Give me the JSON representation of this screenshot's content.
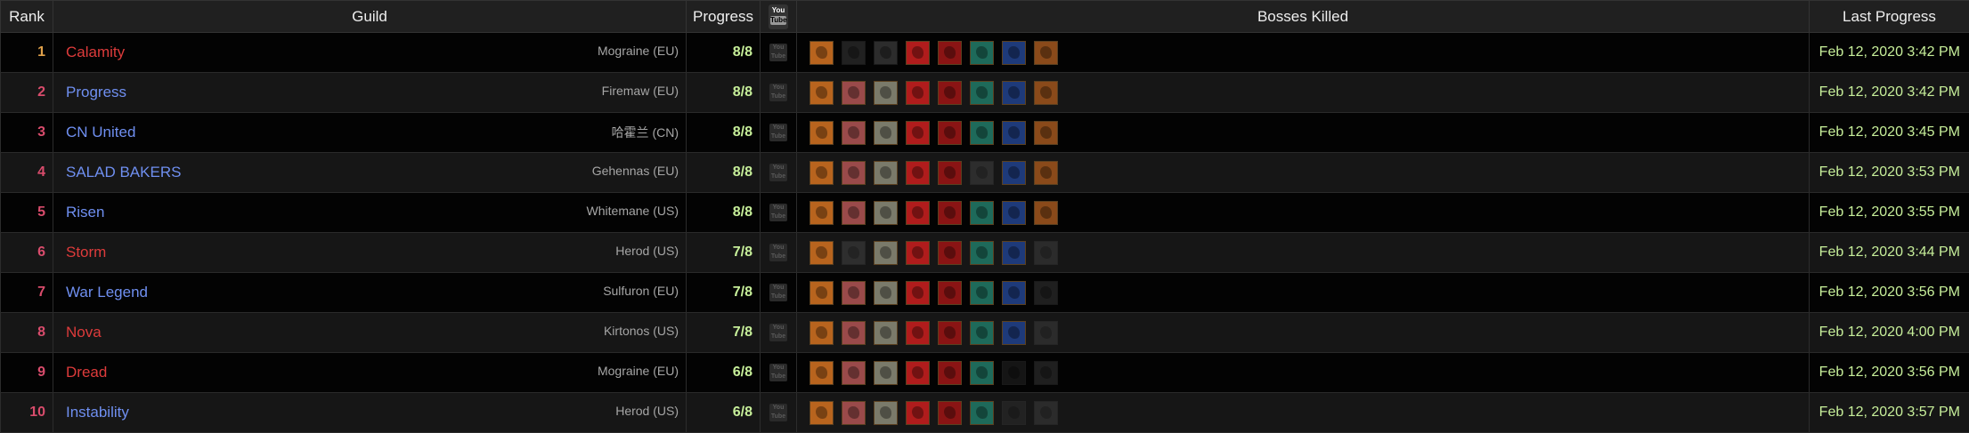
{
  "headers": {
    "rank": "Rank",
    "guild": "Guild",
    "progress": "Progress",
    "bosses": "Bosses Killed",
    "last": "Last Progress",
    "youtube_top": "You",
    "youtube_bottom": "Tube"
  },
  "youtube_icon_text": {
    "top": "You",
    "bottom": "Tube"
  },
  "rows": [
    {
      "rank": "1",
      "guild": "Calamity",
      "faction": "horde",
      "realm": "Mograine (EU)",
      "progress": "8/8",
      "last": "Feb 12, 2020 3:42 PM",
      "bosses": [
        "k",
        "d",
        "d",
        "k",
        "k",
        "k",
        "k",
        "k"
      ]
    },
    {
      "rank": "2",
      "guild": "Progress",
      "faction": "alliance",
      "realm": "Firemaw (EU)",
      "progress": "8/8",
      "last": "Feb 12, 2020 3:42 PM",
      "bosses": [
        "k",
        "k",
        "k",
        "k",
        "k",
        "k",
        "k",
        "k"
      ]
    },
    {
      "rank": "3",
      "guild": "CN United",
      "faction": "alliance",
      "realm": "哈霍兰 (CN)",
      "progress": "8/8",
      "last": "Feb 12, 2020 3:45 PM",
      "bosses": [
        "k",
        "k",
        "k",
        "k",
        "k",
        "k",
        "k",
        "k"
      ]
    },
    {
      "rank": "4",
      "guild": "SALAD BAKERS",
      "faction": "alliance",
      "realm": "Gehennas (EU)",
      "progress": "8/8",
      "last": "Feb 12, 2020 3:53 PM",
      "bosses": [
        "k",
        "k",
        "k",
        "k",
        "k",
        "d",
        "k",
        "k"
      ]
    },
    {
      "rank": "5",
      "guild": "Risen",
      "faction": "alliance",
      "realm": "Whitemane (US)",
      "progress": "8/8",
      "last": "Feb 12, 2020 3:55 PM",
      "bosses": [
        "k",
        "k",
        "k",
        "k",
        "k",
        "k",
        "k",
        "k"
      ]
    },
    {
      "rank": "6",
      "guild": "Storm",
      "faction": "horde",
      "realm": "Herod (US)",
      "progress": "7/8",
      "last": "Feb 12, 2020 3:44 PM",
      "bosses": [
        "k",
        "d",
        "k",
        "k",
        "k",
        "k",
        "k",
        "d"
      ]
    },
    {
      "rank": "7",
      "guild": "War Legend",
      "faction": "alliance",
      "realm": "Sulfuron (EU)",
      "progress": "7/8",
      "last": "Feb 12, 2020 3:56 PM",
      "bosses": [
        "k",
        "k",
        "k",
        "k",
        "k",
        "k",
        "k",
        "d"
      ]
    },
    {
      "rank": "8",
      "guild": "Nova",
      "faction": "horde",
      "realm": "Kirtonos (US)",
      "progress": "7/8",
      "last": "Feb 12, 2020 4:00 PM",
      "bosses": [
        "k",
        "k",
        "k",
        "k",
        "k",
        "k",
        "k",
        "d"
      ]
    },
    {
      "rank": "9",
      "guild": "Dread",
      "faction": "horde",
      "realm": "Mograine (EU)",
      "progress": "6/8",
      "last": "Feb 12, 2020 3:56 PM",
      "bosses": [
        "k",
        "k",
        "k",
        "k",
        "k",
        "k",
        "d",
        "d"
      ]
    },
    {
      "rank": "10",
      "guild": "Instability",
      "faction": "alliance",
      "realm": "Herod (US)",
      "progress": "6/8",
      "last": "Feb 12, 2020 3:57 PM",
      "bosses": [
        "k",
        "k",
        "k",
        "k",
        "k",
        "k",
        "d",
        "d"
      ]
    }
  ],
  "boss_colors": [
    "#b8641e",
    "#9a4a4a",
    "#7a7a6a",
    "#b01c1c",
    "#8a1414",
    "#1e6a5a",
    "#1e3a7a",
    "#8a4a1a"
  ],
  "faction_colors": {
    "horde": "#dd3b3b",
    "alliance": "#6f8ff0"
  }
}
